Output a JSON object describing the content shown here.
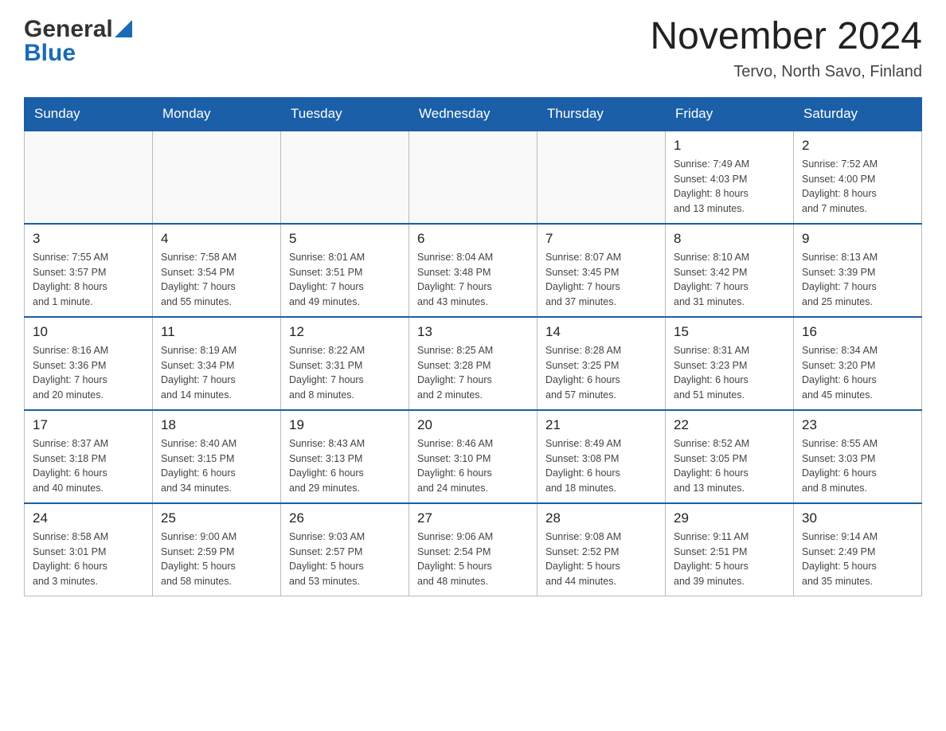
{
  "header": {
    "logo_general": "General",
    "logo_blue": "Blue",
    "title": "November 2024",
    "subtitle": "Tervo, North Savo, Finland"
  },
  "weekdays": [
    "Sunday",
    "Monday",
    "Tuesday",
    "Wednesday",
    "Thursday",
    "Friday",
    "Saturday"
  ],
  "weeks": [
    {
      "days": [
        {
          "number": "",
          "info": ""
        },
        {
          "number": "",
          "info": ""
        },
        {
          "number": "",
          "info": ""
        },
        {
          "number": "",
          "info": ""
        },
        {
          "number": "",
          "info": ""
        },
        {
          "number": "1",
          "info": "Sunrise: 7:49 AM\nSunset: 4:03 PM\nDaylight: 8 hours\nand 13 minutes."
        },
        {
          "number": "2",
          "info": "Sunrise: 7:52 AM\nSunset: 4:00 PM\nDaylight: 8 hours\nand 7 minutes."
        }
      ]
    },
    {
      "days": [
        {
          "number": "3",
          "info": "Sunrise: 7:55 AM\nSunset: 3:57 PM\nDaylight: 8 hours\nand 1 minute."
        },
        {
          "number": "4",
          "info": "Sunrise: 7:58 AM\nSunset: 3:54 PM\nDaylight: 7 hours\nand 55 minutes."
        },
        {
          "number": "5",
          "info": "Sunrise: 8:01 AM\nSunset: 3:51 PM\nDaylight: 7 hours\nand 49 minutes."
        },
        {
          "number": "6",
          "info": "Sunrise: 8:04 AM\nSunset: 3:48 PM\nDaylight: 7 hours\nand 43 minutes."
        },
        {
          "number": "7",
          "info": "Sunrise: 8:07 AM\nSunset: 3:45 PM\nDaylight: 7 hours\nand 37 minutes."
        },
        {
          "number": "8",
          "info": "Sunrise: 8:10 AM\nSunset: 3:42 PM\nDaylight: 7 hours\nand 31 minutes."
        },
        {
          "number": "9",
          "info": "Sunrise: 8:13 AM\nSunset: 3:39 PM\nDaylight: 7 hours\nand 25 minutes."
        }
      ]
    },
    {
      "days": [
        {
          "number": "10",
          "info": "Sunrise: 8:16 AM\nSunset: 3:36 PM\nDaylight: 7 hours\nand 20 minutes."
        },
        {
          "number": "11",
          "info": "Sunrise: 8:19 AM\nSunset: 3:34 PM\nDaylight: 7 hours\nand 14 minutes."
        },
        {
          "number": "12",
          "info": "Sunrise: 8:22 AM\nSunset: 3:31 PM\nDaylight: 7 hours\nand 8 minutes."
        },
        {
          "number": "13",
          "info": "Sunrise: 8:25 AM\nSunset: 3:28 PM\nDaylight: 7 hours\nand 2 minutes."
        },
        {
          "number": "14",
          "info": "Sunrise: 8:28 AM\nSunset: 3:25 PM\nDaylight: 6 hours\nand 57 minutes."
        },
        {
          "number": "15",
          "info": "Sunrise: 8:31 AM\nSunset: 3:23 PM\nDaylight: 6 hours\nand 51 minutes."
        },
        {
          "number": "16",
          "info": "Sunrise: 8:34 AM\nSunset: 3:20 PM\nDaylight: 6 hours\nand 45 minutes."
        }
      ]
    },
    {
      "days": [
        {
          "number": "17",
          "info": "Sunrise: 8:37 AM\nSunset: 3:18 PM\nDaylight: 6 hours\nand 40 minutes."
        },
        {
          "number": "18",
          "info": "Sunrise: 8:40 AM\nSunset: 3:15 PM\nDaylight: 6 hours\nand 34 minutes."
        },
        {
          "number": "19",
          "info": "Sunrise: 8:43 AM\nSunset: 3:13 PM\nDaylight: 6 hours\nand 29 minutes."
        },
        {
          "number": "20",
          "info": "Sunrise: 8:46 AM\nSunset: 3:10 PM\nDaylight: 6 hours\nand 24 minutes."
        },
        {
          "number": "21",
          "info": "Sunrise: 8:49 AM\nSunset: 3:08 PM\nDaylight: 6 hours\nand 18 minutes."
        },
        {
          "number": "22",
          "info": "Sunrise: 8:52 AM\nSunset: 3:05 PM\nDaylight: 6 hours\nand 13 minutes."
        },
        {
          "number": "23",
          "info": "Sunrise: 8:55 AM\nSunset: 3:03 PM\nDaylight: 6 hours\nand 8 minutes."
        }
      ]
    },
    {
      "days": [
        {
          "number": "24",
          "info": "Sunrise: 8:58 AM\nSunset: 3:01 PM\nDaylight: 6 hours\nand 3 minutes."
        },
        {
          "number": "25",
          "info": "Sunrise: 9:00 AM\nSunset: 2:59 PM\nDaylight: 5 hours\nand 58 minutes."
        },
        {
          "number": "26",
          "info": "Sunrise: 9:03 AM\nSunset: 2:57 PM\nDaylight: 5 hours\nand 53 minutes."
        },
        {
          "number": "27",
          "info": "Sunrise: 9:06 AM\nSunset: 2:54 PM\nDaylight: 5 hours\nand 48 minutes."
        },
        {
          "number": "28",
          "info": "Sunrise: 9:08 AM\nSunset: 2:52 PM\nDaylight: 5 hours\nand 44 minutes."
        },
        {
          "number": "29",
          "info": "Sunrise: 9:11 AM\nSunset: 2:51 PM\nDaylight: 5 hours\nand 39 minutes."
        },
        {
          "number": "30",
          "info": "Sunrise: 9:14 AM\nSunset: 2:49 PM\nDaylight: 5 hours\nand 35 minutes."
        }
      ]
    }
  ]
}
